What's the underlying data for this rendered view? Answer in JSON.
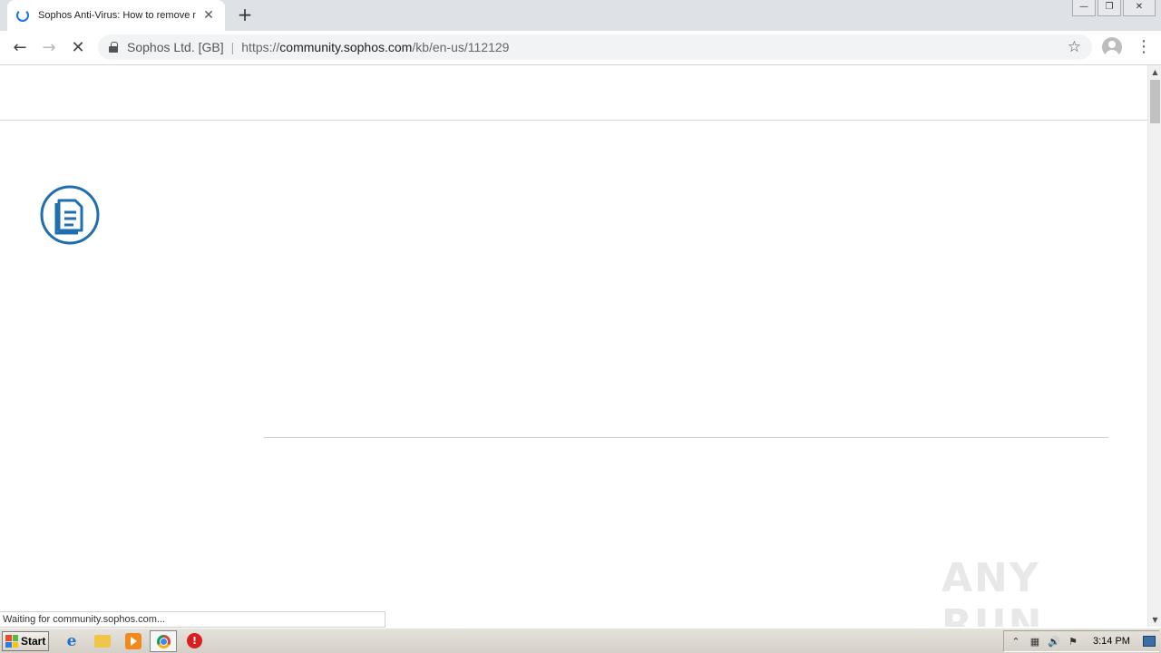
{
  "browser": {
    "tab": {
      "title": "Sophos Anti-Virus: How to remove m",
      "close": "✕"
    },
    "newtab": "+",
    "window_controls": {
      "minimize": "—",
      "maximize": "❐",
      "close": "✕"
    },
    "nav": {
      "back": "←",
      "forward": "→",
      "stop": "✕"
    },
    "omnibox": {
      "org": "Sophos Ltd. [GB]",
      "url_scheme": "https://",
      "url_host": "community.sophos.com",
      "url_path": "/kb/en-us/112129"
    },
    "star": "☆",
    "menu": "⋮"
  },
  "page": {
    "icon": "document-icon",
    "watermark": "ANY RUN"
  },
  "status_bar": {
    "text": "Waiting for community.sophos.com..."
  },
  "scrollbar": {
    "up": "▲",
    "down": "▼"
  },
  "taskbar": {
    "start_label": "Start",
    "ie_glyph": "e",
    "stop_glyph": "!",
    "tray": {
      "arrow": "⌃",
      "network": "▦",
      "volume": "🔊",
      "flag": "⚑",
      "time": "3:14 PM"
    }
  },
  "colors": {
    "accent": "#1a73e8",
    "kb_icon": "#1f6fb0"
  }
}
